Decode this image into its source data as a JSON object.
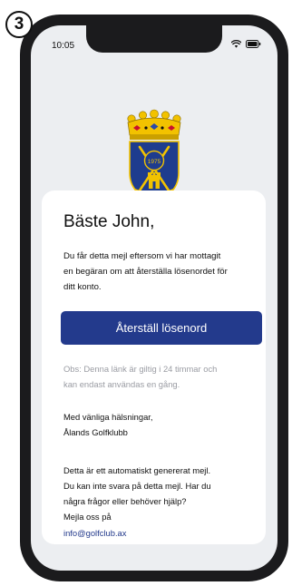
{
  "step_badge": "3",
  "status_bar": {
    "time": "10:05",
    "icons": [
      "wifi-icon",
      "battery-icon"
    ]
  },
  "logo": {
    "year": "1975",
    "icon": "golf-club-crest-icon"
  },
  "email": {
    "greeting": "Bäste John,",
    "intro_lines": [
      "Du får detta mejl eftersom vi har mottagit",
      "en begäran om att återställa lösenordet för",
      "ditt konto."
    ],
    "button_label": "Återställ lösenord",
    "note_lines": [
      "Obs: Denna länk är giltig i 24 timmar och",
      "kan endast användas en gång."
    ],
    "signoff_lines": [
      "Med vänliga hälsningar,",
      "Ålands Golfklubb"
    ],
    "auto_lines": [
      "Detta är ett automatiskt genererat mejl.",
      "Du kan inte svara på detta mejl. Har du",
      "några frågor eller behöver hjälp?",
      "Mejla oss på"
    ],
    "contact_email": "info@golfclub.ax"
  },
  "colors": {
    "brand": "#233a8c",
    "screen_bg": "#eceef1",
    "frame": "#1b1b1d",
    "muted_text": "#9a9ca3"
  }
}
